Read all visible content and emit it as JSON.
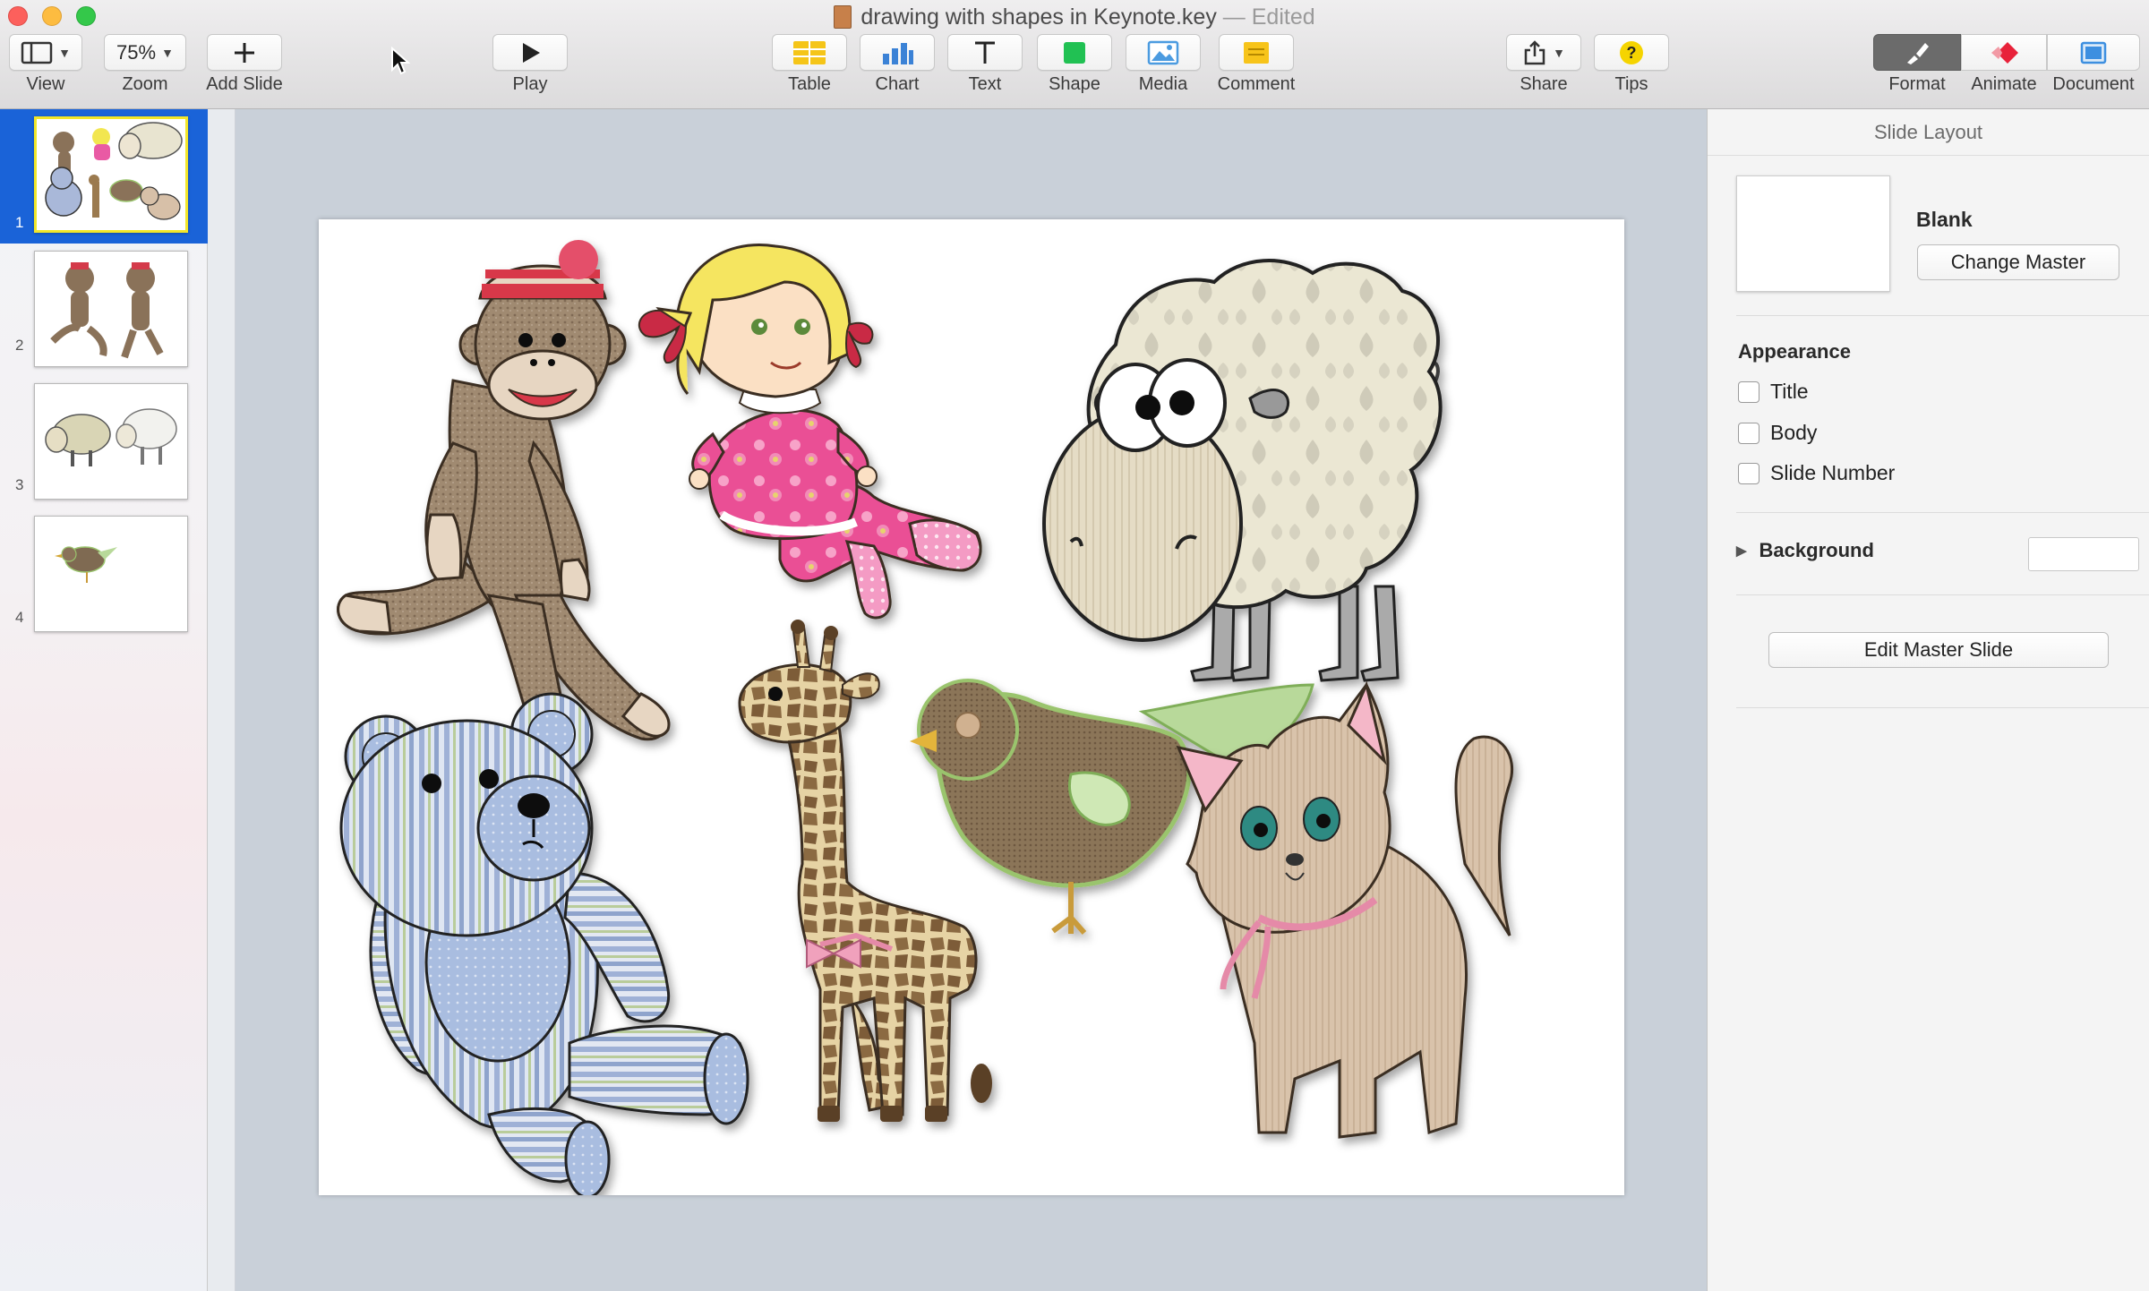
{
  "window": {
    "title": "drawing with shapes in Keynote.key",
    "separator": "—",
    "status": "Edited"
  },
  "toolbar": {
    "view_label": "View",
    "zoom_value": "75%",
    "zoom_label": "Zoom",
    "add_slide_label": "Add Slide",
    "play_label": "Play",
    "table_label": "Table",
    "chart_label": "Chart",
    "text_label": "Text",
    "shape_label": "Shape",
    "media_label": "Media",
    "comment_label": "Comment",
    "share_label": "Share",
    "tips_label": "Tips",
    "tips_glyph": "?",
    "format_label": "Format",
    "animate_label": "Animate",
    "document_label": "Document",
    "accent_colors": {
      "table": "#f5c518",
      "chart": "#3b82d6",
      "shape": "#21c153",
      "media": "#4b9be0",
      "comment": "#f7c41a",
      "tips": "#f5d400",
      "animate": "#e8223a",
      "document": "#3d8fe0"
    }
  },
  "navigator": {
    "selected_color": "#1a63d8",
    "slides": [
      {
        "number": "1",
        "selected": true
      },
      {
        "number": "2",
        "selected": false
      },
      {
        "number": "3",
        "selected": false
      },
      {
        "number": "4",
        "selected": false
      }
    ]
  },
  "inspector": {
    "header": "Slide Layout",
    "master_name": "Blank",
    "change_master": "Change Master",
    "appearance_title": "Appearance",
    "options": [
      {
        "label": "Title",
        "checked": false
      },
      {
        "label": "Body",
        "checked": false
      },
      {
        "label": "Slide Number",
        "checked": false
      }
    ],
    "background_label": "Background",
    "edit_master": "Edit Master Slide"
  },
  "slide_content": {
    "shapes": [
      "sock-monkey",
      "doll",
      "sheep",
      "teddy-bear",
      "giraffe",
      "bird",
      "kitten"
    ]
  }
}
